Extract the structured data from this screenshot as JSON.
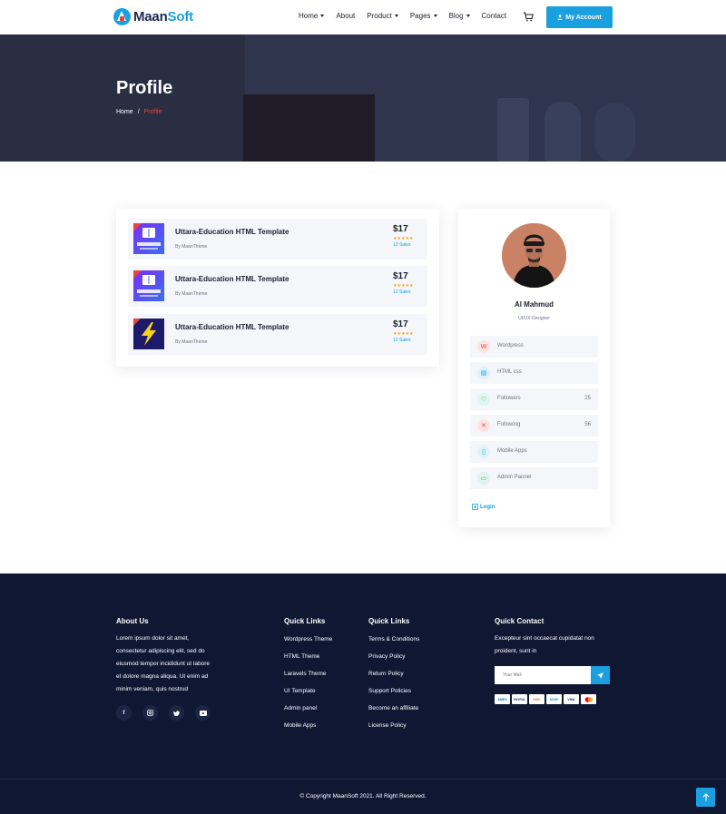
{
  "header": {
    "logo_part1": "Maan",
    "logo_part2": "Soft",
    "nav": [
      {
        "label": "Home",
        "dropdown": true
      },
      {
        "label": "About",
        "dropdown": false
      },
      {
        "label": "Product",
        "dropdown": true
      },
      {
        "label": "Pages",
        "dropdown": true
      },
      {
        "label": "Blog",
        "dropdown": true
      },
      {
        "label": "Contact",
        "dropdown": false
      }
    ],
    "account_label": "My Account"
  },
  "hero": {
    "title": "Profile",
    "breadcrumb": [
      "Home",
      "/",
      "Profile"
    ]
  },
  "products": [
    {
      "title": "Uttara-Education HTML Template",
      "author": "By MaanTheme",
      "price": "$17",
      "rating": "★★★★★",
      "sales": "12 Sales",
      "thumb": "uttara-university"
    },
    {
      "title": "Uttara-Education HTML Template",
      "author": "By MaanTheme",
      "price": "$17",
      "rating": "★★★★★",
      "sales": "12 Sales",
      "thumb": "uttara-university"
    },
    {
      "title": "Uttara-Education HTML Template",
      "author": "By MaanTheme",
      "price": "$17",
      "rating": "★★★★★",
      "sales": "12 Sales",
      "thumb": "lightning"
    }
  ],
  "profile": {
    "name": "Al Mahmud",
    "role": "UI/UX Designer",
    "items": [
      {
        "label": "Wordpress",
        "count": "",
        "icon": "wordpress-icon",
        "color": "#e8443a"
      },
      {
        "label": "HTML css",
        "count": "",
        "icon": "document-icon",
        "color": "#1aa0e0"
      },
      {
        "label": "Followers",
        "count": "25",
        "icon": "heart-icon",
        "color": "#2fb97a"
      },
      {
        "label": "Following",
        "count": "56",
        "icon": "users-icon",
        "color": "#e8443a"
      },
      {
        "label": "Mobile Apps",
        "count": "",
        "icon": "mobile-icon",
        "color": "#1aa0e0"
      },
      {
        "label": "Admin Pannel",
        "count": "",
        "icon": "monitor-icon",
        "color": "#2fb97a"
      }
    ],
    "login_label": "Login"
  },
  "footer": {
    "about": {
      "heading": "About Us",
      "lines": [
        "Lorem ipsum dolor sit amet,",
        "consectetur adipiscing elit, sed do",
        "eiusmod tempor incididunt ut labore",
        "et dolore magna aliqua. Ut enim ad",
        "minim veniam, quis nostrud"
      ],
      "social": [
        "f",
        "ig",
        "tw",
        "yt"
      ]
    },
    "links1": {
      "heading": "Quick Links",
      "items": [
        "Wordpress Theme",
        "HTML Theme",
        "Laravels Theme",
        "UI Template",
        "Admin panel",
        "Mobile Apps"
      ]
    },
    "links2": {
      "heading": "Quick Links",
      "items": [
        "Terms & Conditions",
        "Privacy Policy",
        "Return Policy",
        "Support Policies",
        "Become an affiliate",
        "License Policy"
      ]
    },
    "contact": {
      "heading": "Quick Contact",
      "lines": [
        "Excepteur sint occaecat cupidatat non",
        "proident, sunt in"
      ],
      "mail_placeholder": "Your Mail",
      "payments": [
        "AMEX",
        "PAYPAL",
        "DISC",
        "MOBI",
        "VISA",
        "MC"
      ]
    },
    "copyright": "© Copyright MaanSoft 2021. All Right Reserved."
  },
  "colors": {
    "accent": "#1aa0e0",
    "danger": "#e8443a",
    "footer_bg": "#0f1733",
    "star": "#f5a623"
  }
}
